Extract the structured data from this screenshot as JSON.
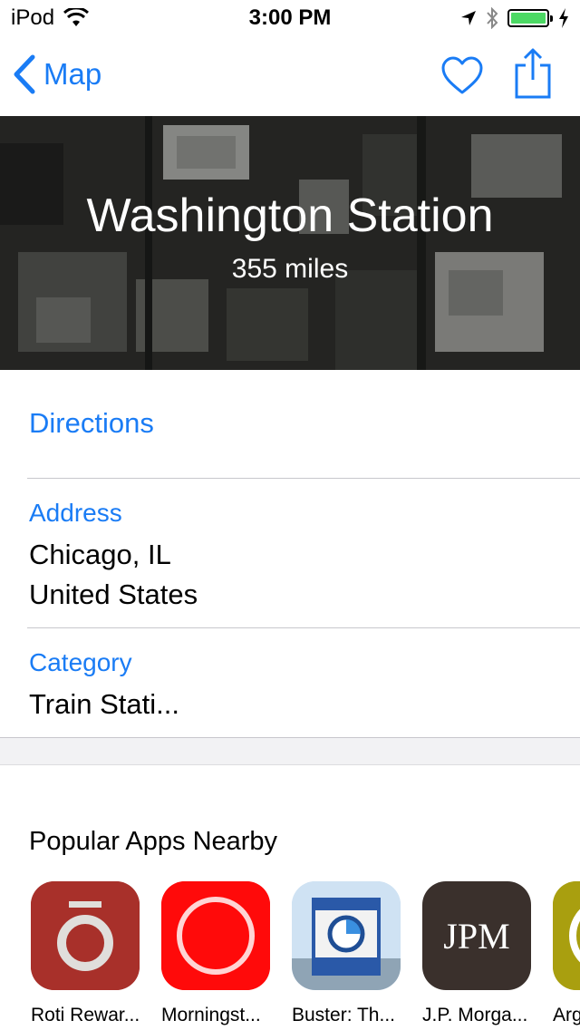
{
  "status_bar": {
    "carrier": "iPod",
    "time": "3:00 PM",
    "battery_level": 1.0
  },
  "nav": {
    "back_label": "Map",
    "accent_color": "#1a7cf5"
  },
  "hero": {
    "title": "Washington Station",
    "subtitle": "355 miles"
  },
  "details": {
    "directions_label": "Directions",
    "address_label": "Address",
    "address_line1": "Chicago, IL",
    "address_line2": "United States",
    "category_label": "Category",
    "category_value": "Train Stati..."
  },
  "popular_apps": {
    "title": "Popular Apps Nearby",
    "apps": [
      {
        "name": "Roti Rewar...",
        "icon": "roti-icon"
      },
      {
        "name": "Morningst...",
        "icon": "morningstar-icon"
      },
      {
        "name": "Buster: Th...",
        "icon": "buster-icon"
      },
      {
        "name": "J.P. Morga...",
        "icon": "jpm-icon",
        "icon_text": "JPM"
      },
      {
        "name": "Arg",
        "icon": "arg-icon"
      }
    ]
  }
}
